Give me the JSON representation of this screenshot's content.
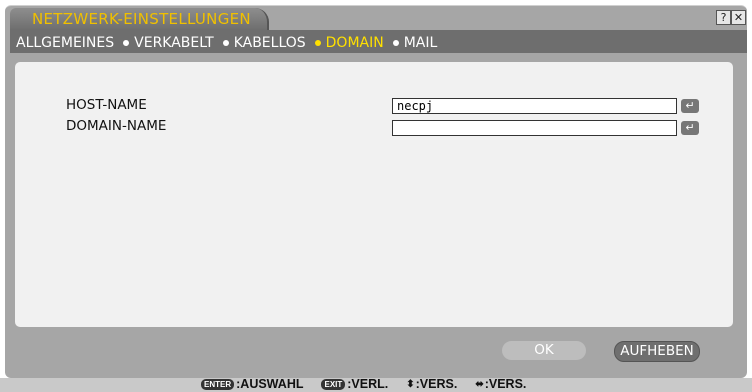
{
  "window": {
    "title": "NETZWERK-EINSTELLUNGEN",
    "help_label": "?",
    "close_label": "✕"
  },
  "nav": {
    "items": [
      {
        "label": "ALLGEMEINES"
      },
      {
        "label": "VERKABELT"
      },
      {
        "label": "KABELLOS"
      },
      {
        "label": "DOMAIN",
        "active": true
      },
      {
        "label": "MAIL"
      }
    ]
  },
  "form": {
    "host_name_label": "HOST-NAME",
    "host_name_value": "necpj",
    "domain_name_label": "DOMAIN-NAME",
    "domain_name_value": "",
    "enter_glyph": "↵"
  },
  "buttons": {
    "ok": "OK",
    "cancel": "AUFHEBEN"
  },
  "status_bar": {
    "enter_key": "ENTER",
    "enter_text": ":AUSWAHL",
    "exit_key": "EXIT",
    "exit_text": ":VERL.",
    "updown_glyph": "⬍",
    "updown_text": ":VERS.",
    "leftright_glyph": "⬌",
    "leftright_text": ":VERS."
  },
  "colors": {
    "accent": "#ffe000",
    "title": "#f0c000",
    "frame": "#a6a6a6"
  }
}
